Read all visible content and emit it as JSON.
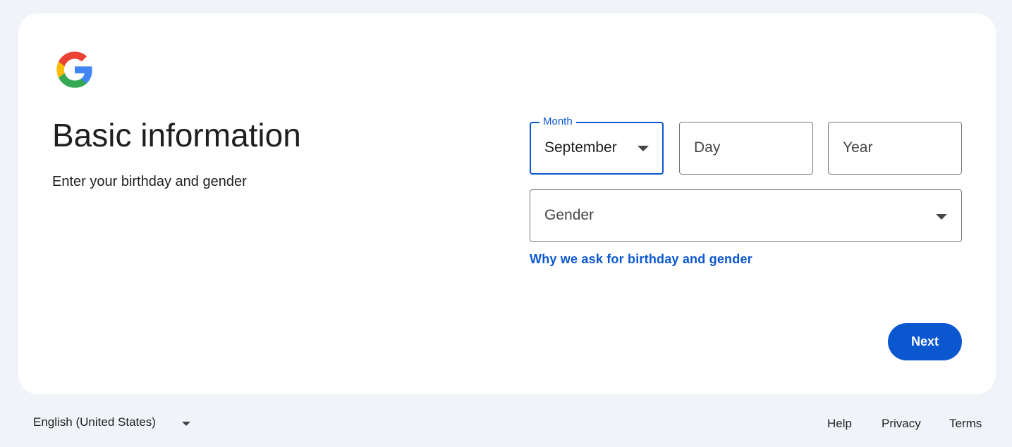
{
  "header": {
    "logo_icon": "google-g-logo",
    "title": "Basic information",
    "subtitle": "Enter your birthday and gender"
  },
  "form": {
    "month": {
      "label": "Month",
      "value": "September"
    },
    "day": {
      "placeholder": "Day",
      "value": ""
    },
    "year": {
      "placeholder": "Year",
      "value": ""
    },
    "gender": {
      "placeholder": "Gender",
      "value": ""
    },
    "why_link": "Why we ask for birthday and gender",
    "next_label": "Next"
  },
  "footer": {
    "language": "English (United States)",
    "links": {
      "help": "Help",
      "privacy": "Privacy",
      "terms": "Terms"
    }
  },
  "colors": {
    "accent": "#0b57d0",
    "background": "#f0f4f9",
    "card": "#ffffff",
    "border": "#747775"
  }
}
